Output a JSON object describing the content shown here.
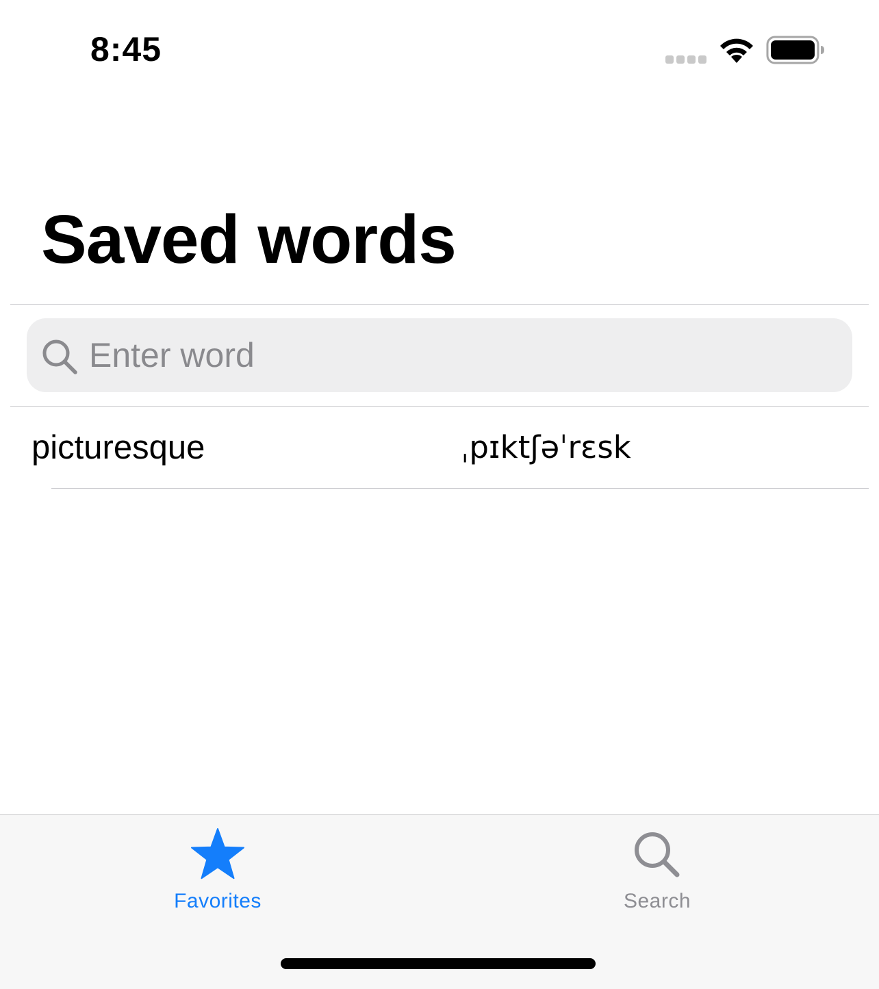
{
  "status_bar": {
    "time": "8:45"
  },
  "header": {
    "title": "Saved words"
  },
  "search": {
    "placeholder": "Enter word",
    "value": "",
    "icon": "search-icon"
  },
  "words": [
    {
      "word": "picturesque",
      "pronunciation": "ˌpɪktʃəˈrɛsk"
    }
  ],
  "tab_bar": {
    "tabs": [
      {
        "label": "Favorites",
        "icon": "star-icon",
        "selected": true
      },
      {
        "label": "Search",
        "icon": "search-icon",
        "selected": false
      }
    ]
  },
  "colors": {
    "accent": "#147efb",
    "inactive_tab": "#8e8e93",
    "search_background": "#eeeeef",
    "tab_bar_background": "#f7f7f7",
    "placeholder_text": "#8a8a8e",
    "separator": "#c8c8cc"
  }
}
